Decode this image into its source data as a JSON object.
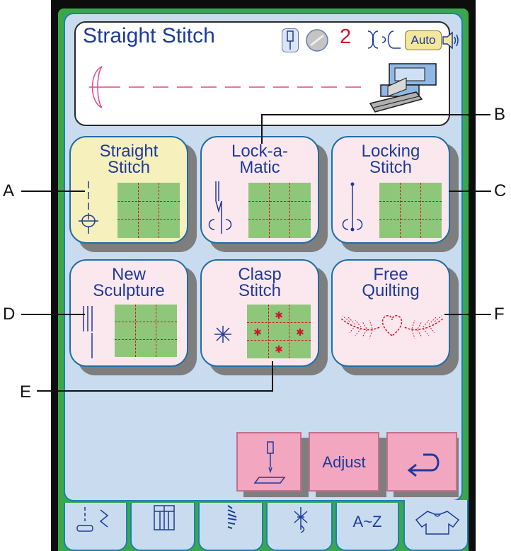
{
  "header": {
    "title": "Straight Stitch",
    "pressure_value": "2",
    "auto_label": "Auto"
  },
  "tiles": [
    {
      "label_line1": "Straight",
      "label_line2": "Stitch",
      "selected": true
    },
    {
      "label_line1": "Lock-a-",
      "label_line2": "Matic",
      "selected": false
    },
    {
      "label_line1": "Locking",
      "label_line2": "Stitch",
      "selected": false
    },
    {
      "label_line1": "New",
      "label_line2": "Sculpture",
      "selected": false
    },
    {
      "label_line1": "Clasp",
      "label_line2": "Stitch",
      "selected": false
    },
    {
      "label_line1": "Free",
      "label_line2": "Quilting",
      "selected": false
    }
  ],
  "callouts": {
    "a": "A",
    "b": "B",
    "c": "C",
    "d": "D",
    "e": "E",
    "f": "F"
  },
  "buttons": {
    "adjust_label": "Adjust"
  },
  "tabs": {
    "alpha_label": "A~Z"
  },
  "colors": {
    "screen_bg": "#c9dcef",
    "tile_bg": "#fbe8ee",
    "tile_selected_bg": "#f6f0bd",
    "button_bg": "#f2a6c0",
    "label_blue": "#1e3a9a",
    "accent_red": "#d0142a",
    "grid_green": "#8fc77a"
  }
}
